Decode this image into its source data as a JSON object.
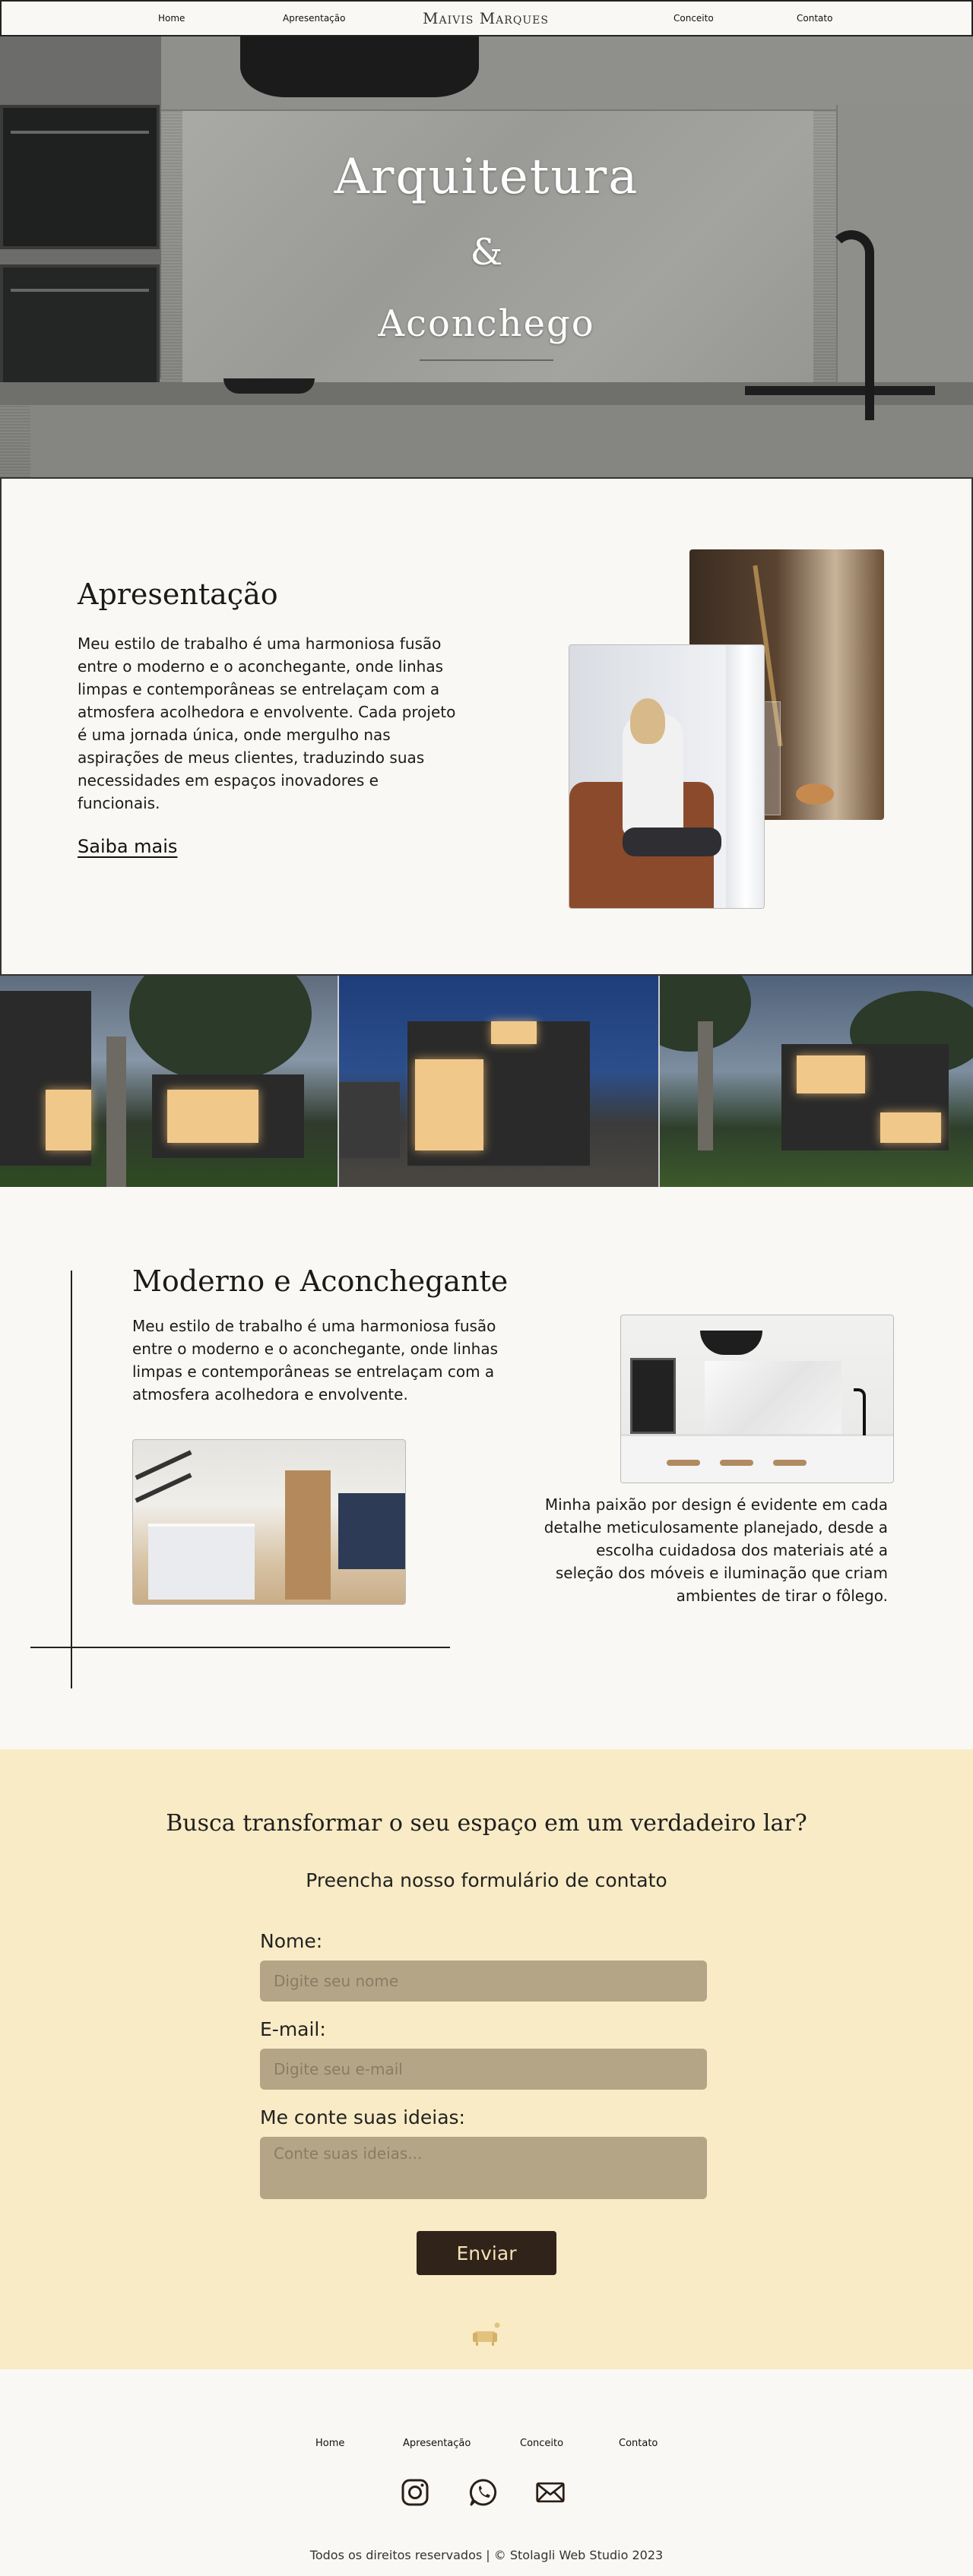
{
  "nav": {
    "home": "Home",
    "apresentacao": "Apresentação",
    "brand": "Maivis Marques",
    "conceito": "Conceito",
    "contato": "Contato"
  },
  "hero": {
    "line1": "Arquitetura",
    "line2": "&",
    "line3": "Aconchego"
  },
  "apresentacao": {
    "title": "Apresentação",
    "text": "Meu estilo de trabalho é uma harmoniosa fusão entre o moderno e o aconchegante, onde linhas limpas e contemporâneas se entrelaçam com a atmosfera acolhedora e envolvente. Cada projeto é uma jornada única, onde mergulho nas aspirações de meus clientes, traduzindo suas necessidades em espaços inovadores e funcionais.",
    "more": "Saiba mais"
  },
  "moderno": {
    "title": "Moderno e Aconchegante",
    "text1": "Meu estilo de trabalho é uma harmoniosa fusão entre o moderno e o aconchegante, onde linhas limpas e contemporâneas se entrelaçam com a atmosfera acolhedora e envolvente.",
    "text2": "Minha paixão por design é evidente em cada detalhe meticulosamente planejado, desde a escolha cuidadosa dos materiais até a seleção dos móveis e iluminação que criam ambientes de tirar o fôlego."
  },
  "contact": {
    "title": "Busca transformar o seu espaço em um verdadeiro lar?",
    "subtitle": "Preencha nosso formulário de contato",
    "name_label": "Nome:",
    "name_placeholder": "Digite seu nome",
    "email_label": "E-mail:",
    "email_placeholder": "Digite seu e-mail",
    "ideas_label": "Me conte suas ideias:",
    "ideas_placeholder": "Conte suas ideias...",
    "send": "Enviar"
  },
  "footer": {
    "home": "Home",
    "apresentacao": "Apresentação",
    "conceito": "Conceito",
    "contato": "Contato",
    "icons": [
      "instagram-icon",
      "whatsapp-icon",
      "email-icon"
    ],
    "copyright": "Todos os direitos reservados | © Stolagli Web Studio 2023"
  },
  "colors": {
    "background": "#faf8f4",
    "contact_bg": "#f9ebc5",
    "field_bg": "#b5a587",
    "button_bg": "#2f231a",
    "button_text": "#f5e3b5"
  }
}
